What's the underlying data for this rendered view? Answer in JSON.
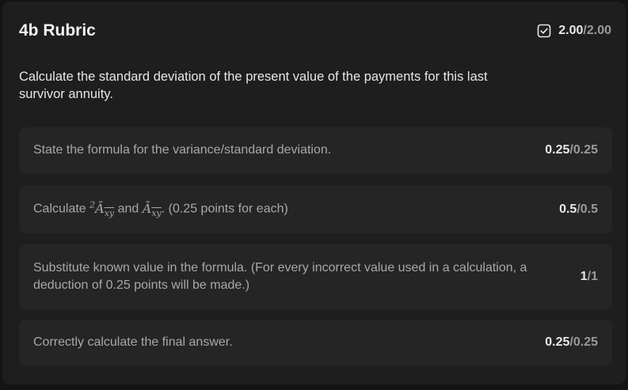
{
  "rubric": {
    "title": "4b Rubric",
    "total_earned": "2.00",
    "total_possible": "/2.00",
    "description": "Calculate the standard deviation of the present value of the payments for this last survivor annuity.",
    "status_icon": "checked-box-icon"
  },
  "criteria": [
    {
      "text": "State the formula for the variance/standard deviation.",
      "earned": "0.25",
      "possible": "/0.25"
    },
    {
      "text_before": "Calculate",
      "math1_sup": "2",
      "math1_base": "Ā",
      "math1_sub": "xy",
      "text_middle": "and",
      "math2_base": "Ā",
      "math2_sub": "xy",
      "text_after": ". (0.25 points for each)",
      "earned": "0.5",
      "possible": "/0.5"
    },
    {
      "text": "Substitute known value in the formula. (For every incorrect value used in a calculation, a deduction of 0.25 points will be made.)",
      "earned": "1",
      "possible": "/1"
    },
    {
      "text": "Correctly calculate the final answer.",
      "earned": "0.25",
      "possible": "/0.25"
    }
  ]
}
